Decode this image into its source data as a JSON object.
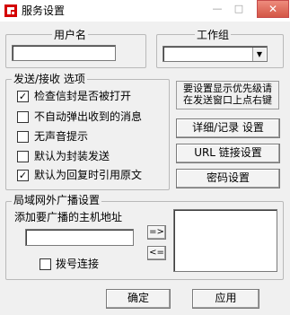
{
  "window": {
    "title": "服务设置",
    "minimize": "—",
    "maximize": "□",
    "close": "✕"
  },
  "user": {
    "label": "用户名",
    "value": ""
  },
  "workgroup": {
    "label": "工作组",
    "value": ""
  },
  "send_receive": {
    "legend": "发送/接收 选项",
    "options": [
      {
        "label": "检查信封是否被打开",
        "checked": true
      },
      {
        "label": "不自动弹出收到的消息",
        "checked": false
      },
      {
        "label": "无声音提示",
        "checked": false
      },
      {
        "label": "默认为封装发送",
        "checked": false
      },
      {
        "label": "默认为回复时引用原文",
        "checked": true
      }
    ]
  },
  "notice": {
    "line1": "要设置显示优先级请",
    "line2": "在发送窗口上点右键"
  },
  "buttons": {
    "details": "详细/记录 设置",
    "url": "URL 链接设置",
    "password": "密码设置",
    "ok": "确定",
    "apply": "应用",
    "add": "=>",
    "remove": "<="
  },
  "broadcast": {
    "legend": "局域网外广播设置",
    "host_label": "添加要广播的主机地址",
    "host_value": "",
    "dialup_label": "拨号连接",
    "dialup_checked": false
  },
  "icons": {
    "app": "red-app-icon"
  },
  "colors": {
    "app_icon": "#d40000",
    "close_button": "#d35645"
  }
}
